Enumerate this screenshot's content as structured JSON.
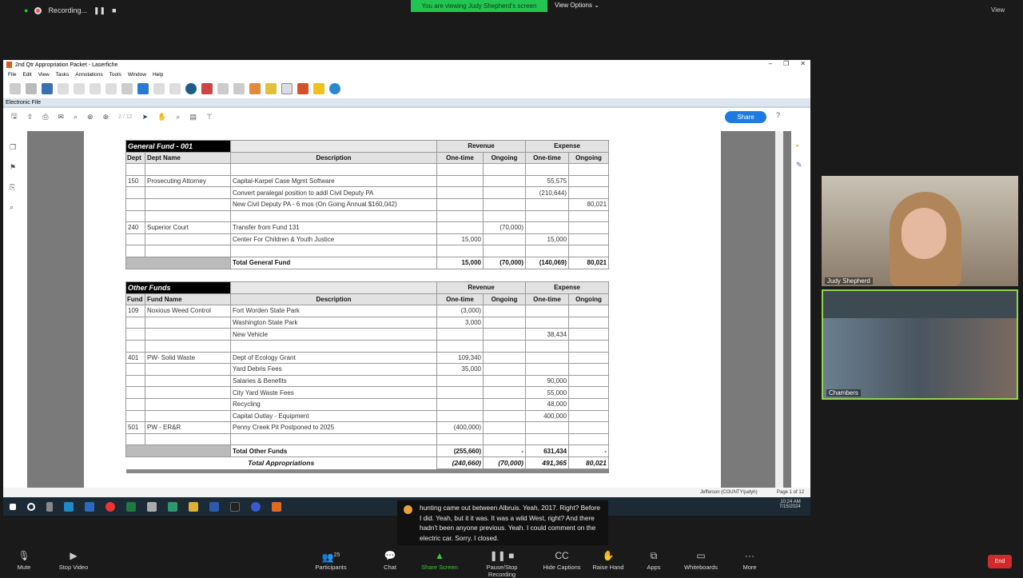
{
  "zoom_top": {
    "recording": "Recording...",
    "banner": "You are viewing Judy Shepherd's screen",
    "view_options": "View Options",
    "view": "View"
  },
  "app": {
    "title": "2nd Qtr Appropriation Packet - Laserfiche",
    "menus": [
      "File",
      "Edit",
      "View",
      "Tasks",
      "Annotations",
      "Tools",
      "Window",
      "Help"
    ],
    "panel": "Electronic File",
    "page_indicator": "2 / 12",
    "share": "Share",
    "status_user": "Jefferson (COUNTY\\judyh)",
    "status_page": "Page 1 of 12"
  },
  "general_fund": {
    "title": "General Fund - 001",
    "headers": {
      "dept": "Dept",
      "name": "Dept Name",
      "desc": "Description",
      "revenue": "Revenue",
      "expense": "Expense",
      "onetime": "One-time",
      "ongoing": "Ongoing"
    },
    "rows": [
      [
        "",
        "",
        "",
        "",
        "",
        "",
        ""
      ],
      [
        "150",
        "Prosecuting Attorney",
        "Capital-Karpel Case Mgmt Software",
        "",
        "",
        "55,575",
        ""
      ],
      [
        "",
        "",
        "Convert paralegal position to addl Civil Deputy PA",
        "",
        "",
        "(210,644)",
        ""
      ],
      [
        "",
        "",
        "New Civil Deputy PA - 6 mos (On Going Annual $160,042)",
        "",
        "",
        "",
        "80,021"
      ],
      [
        "",
        "",
        "",
        "",
        "",
        "",
        ""
      ],
      [
        "240",
        "Superior Court",
        "Transfer from Fund 131",
        "",
        "(70,000)",
        "",
        ""
      ],
      [
        "",
        "",
        "Center For Children & Youth Justice",
        "15,000",
        "",
        "15,000",
        ""
      ],
      [
        "",
        "",
        "",
        "",
        "",
        "",
        ""
      ]
    ],
    "total": [
      "Total General Fund",
      "15,000",
      "(70,000)",
      "(140,069)",
      "80,021"
    ]
  },
  "other_funds": {
    "title": "Other Funds",
    "headers": {
      "dept": "Fund",
      "name": "Fund Name",
      "desc": "Description",
      "revenue": "Revenue",
      "expense": "Expense",
      "onetime": "One-time",
      "ongoing": "Ongoing"
    },
    "rows": [
      [
        "109",
        "Noxious Weed Control",
        "Fort Worden State Park",
        "(3,000)",
        "",
        "",
        ""
      ],
      [
        "",
        "",
        "Washington State Park",
        "3,000",
        "",
        "",
        ""
      ],
      [
        "",
        "",
        "New Vehicle",
        "",
        "",
        "38,434",
        ""
      ],
      [
        "",
        "",
        "",
        "",
        "",
        "",
        ""
      ],
      [
        "401",
        "PW- Solid Waste",
        "Dept of Ecology Grant",
        "109,340",
        "",
        "",
        ""
      ],
      [
        "",
        "",
        "Yard Debris Fees",
        "35,000",
        "",
        "",
        ""
      ],
      [
        "",
        "",
        "Salaries & Benefits",
        "",
        "",
        "90,000",
        ""
      ],
      [
        "",
        "",
        "City Yard Waste Fees",
        "",
        "",
        "55,000",
        ""
      ],
      [
        "",
        "",
        "Recycling",
        "",
        "",
        "48,000",
        ""
      ],
      [
        "",
        "",
        "Capital Outlay - Equipment",
        "",
        "",
        "400,000",
        ""
      ],
      [
        "501",
        "PW - ER&R",
        "Penny Creek Pit Postponed to 2025",
        "(400,000)",
        "",
        "",
        ""
      ],
      [
        "",
        "",
        "",
        "",
        "",
        "",
        ""
      ]
    ],
    "total": [
      "Total Other Funds",
      "(255,660)",
      "-",
      "631,434",
      "-"
    ],
    "grand": [
      "Total Appropriations",
      "(240,660)",
      "(70,000)",
      "491,365",
      "80,021"
    ]
  },
  "taskbar": {
    "time": "10:24 AM",
    "date": "7/15/2024"
  },
  "caption": "hunting came out between Albruis. Yeah, 2017. Right? Before I did. Yeah, but it it was. It was a wild West, right? And there hadn't been anyone previous. Yeah. I could comment on the electric car. Sorry. I closed.",
  "videos": [
    {
      "name": "Judy Shepherd"
    },
    {
      "name": "Chambers"
    }
  ],
  "controls": {
    "mute": "Mute",
    "video": "Stop Video",
    "participants": "Participants",
    "participants_count": "25",
    "chat": "Chat",
    "share": "Share Screen",
    "recording": "Pause/Stop Recording",
    "captions": "Hide Captions",
    "raise": "Raise Hand",
    "apps": "Apps",
    "whiteboards": "Whiteboards",
    "more": "More",
    "end": "End"
  },
  "colors": {
    "banner": "#23c552",
    "share": "#1f7ae0",
    "end": "#d02a2a",
    "active_speaker": "#8ed64c"
  }
}
